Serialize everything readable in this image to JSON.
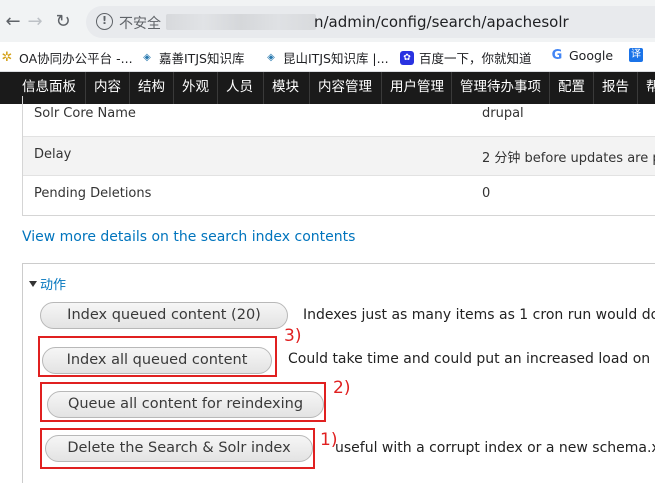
{
  "browser": {
    "insecure_label": "不安全",
    "url_visible": "n/admin/config/search/apachesolr",
    "bookmarks": [
      "OA协同办公平台 -...",
      "嘉善ITJS知识库",
      "昆山ITJS知识库 |...",
      "百度一下，你就知道",
      "Google"
    ]
  },
  "toolbar": {
    "items": [
      "信息面板",
      "内容",
      "结构",
      "外观",
      "人员",
      "模块",
      "内容管理",
      "用户管理",
      "管理待办事项",
      "配置",
      "报告",
      "帮"
    ]
  },
  "status_table": {
    "rows": [
      {
        "key": "Solr Core Name",
        "value": "drupal"
      },
      {
        "key": "Delay",
        "value": "2 分钟 before updates are p"
      },
      {
        "key": "Pending Deletions",
        "value": "0"
      }
    ]
  },
  "details_link": "View more details on the search index contents",
  "actions": {
    "legend": "动作",
    "buttons": [
      {
        "label": "Index queued content (20)",
        "description": "Indexes just as many items as 1 cron run would do"
      },
      {
        "label": "Index all queued content",
        "description": "Could take time and could put an increased load on y"
      },
      {
        "label": "Queue all content for reindexing",
        "description": ""
      },
      {
        "label": "Delete the Search & Solr index",
        "description": "useful with a corrupt index or a new schema.x"
      }
    ]
  },
  "annotations": [
    "3)",
    "2)",
    "1)"
  ],
  "colors": {
    "link": "#0074bd",
    "toolbar": "#1a1a1a",
    "annotation": "#e02020"
  }
}
